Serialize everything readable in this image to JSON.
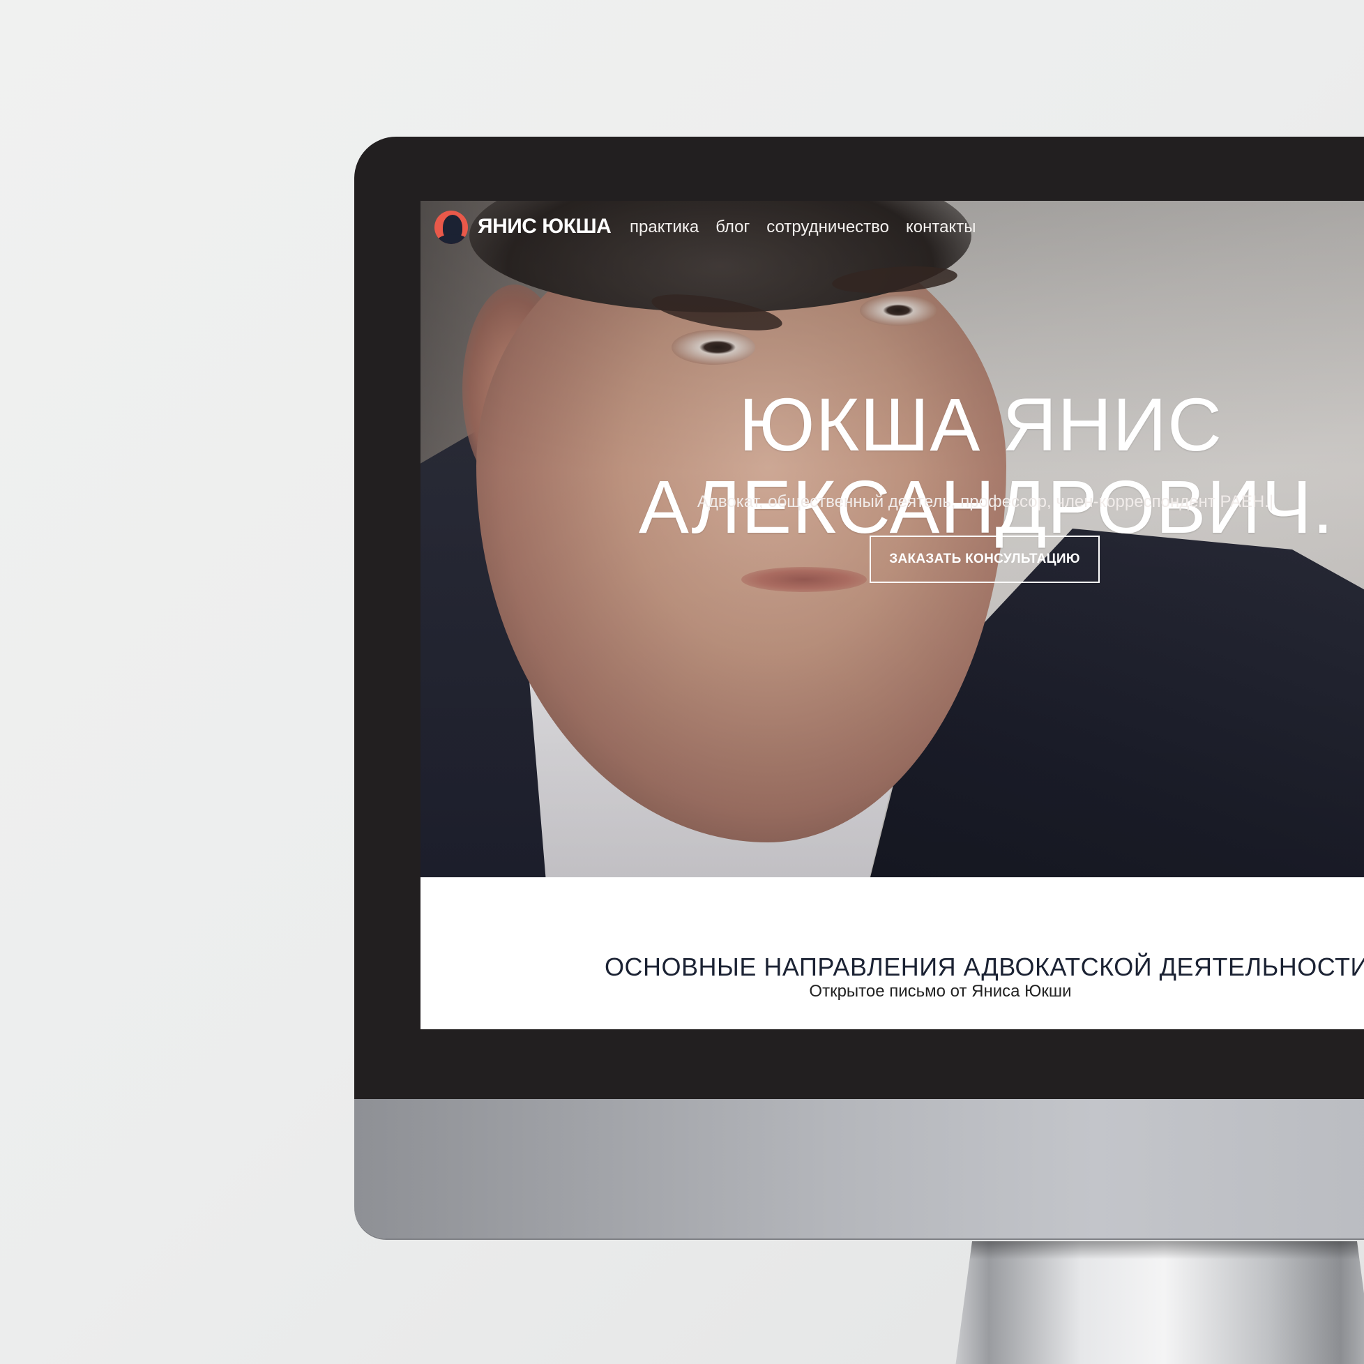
{
  "site": {
    "brand": "ЯНИС ЮКША",
    "nav": [
      {
        "label": "практика"
      },
      {
        "label": "блог"
      },
      {
        "label": "сотрудничество"
      },
      {
        "label": "контакты"
      }
    ]
  },
  "hero": {
    "title_line1": "ЮКША ЯНИС",
    "title_line2": "АЛЕКСАНДРОВИЧ.",
    "subtitle": "Адвокат, общественный деятель, профессор, член-корреспондент РАЕН.|",
    "cta_label": "ЗАКАЗАТЬ КОНСУЛЬТАЦИЮ"
  },
  "section": {
    "title": "ОСНОВНЫЕ НАПРАВЛЕНИЯ АДВОКАТСКОЙ ДЕЯТЕЛЬНОСТИ",
    "subtitle": "Открытое письмо от Яниса Юкши"
  },
  "colors": {
    "logo_accent": "#e9594a",
    "logo_dark": "#1b2233",
    "bezel": "#221f20",
    "section_title": "#1b2233"
  },
  "icons": {
    "logo": "portrait-logo-icon"
  }
}
